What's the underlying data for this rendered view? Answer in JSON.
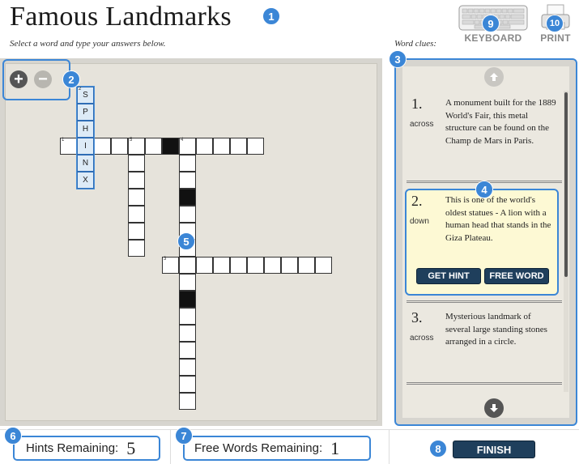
{
  "header": {
    "title": "Famous Landmarks",
    "subtitle": "Select a word and type your answers below.",
    "clues_caption": "Word clues:",
    "keyboard_label": "KEYBOARD",
    "print_label": "PRINT"
  },
  "zoom": {
    "in_icon": "plus-icon",
    "out_icon": "minus-icon"
  },
  "grid": {
    "cells": [
      {
        "r": 0,
        "c": 4,
        "l": "S",
        "n": "2",
        "sel": true
      },
      {
        "r": 1,
        "c": 4,
        "l": "P",
        "sel": true
      },
      {
        "r": 2,
        "c": 4,
        "l": "H",
        "sel": true
      },
      {
        "r": 3,
        "c": 3,
        "n": "1"
      },
      {
        "r": 3,
        "c": 4,
        "l": "I",
        "sel": true
      },
      {
        "r": 3,
        "c": 5
      },
      {
        "r": 3,
        "c": 6
      },
      {
        "r": 3,
        "c": 7,
        "n": "5"
      },
      {
        "r": 3,
        "c": 8
      },
      {
        "r": 3,
        "c": 9,
        "black": true
      },
      {
        "r": 3,
        "c": 10,
        "n": "4"
      },
      {
        "r": 3,
        "c": 11
      },
      {
        "r": 3,
        "c": 12
      },
      {
        "r": 3,
        "c": 13
      },
      {
        "r": 3,
        "c": 14
      },
      {
        "r": 4,
        "c": 4,
        "l": "N",
        "sel": true
      },
      {
        "r": 4,
        "c": 7
      },
      {
        "r": 4,
        "c": 10
      },
      {
        "r": 5,
        "c": 4,
        "l": "X",
        "sel": true
      },
      {
        "r": 5,
        "c": 7
      },
      {
        "r": 5,
        "c": 10
      },
      {
        "r": 6,
        "c": 7
      },
      {
        "r": 6,
        "c": 10,
        "black": true
      },
      {
        "r": 7,
        "c": 7
      },
      {
        "r": 7,
        "c": 10
      },
      {
        "r": 8,
        "c": 7
      },
      {
        "r": 8,
        "c": 10
      },
      {
        "r": 9,
        "c": 7
      },
      {
        "r": 9,
        "c": 10
      },
      {
        "r": 10,
        "c": 9,
        "n": "3"
      },
      {
        "r": 10,
        "c": 10
      },
      {
        "r": 10,
        "c": 11
      },
      {
        "r": 10,
        "c": 12
      },
      {
        "r": 10,
        "c": 13
      },
      {
        "r": 10,
        "c": 14
      },
      {
        "r": 10,
        "c": 15
      },
      {
        "r": 10,
        "c": 16
      },
      {
        "r": 10,
        "c": 17
      },
      {
        "r": 10,
        "c": 18
      },
      {
        "r": 11,
        "c": 10
      },
      {
        "r": 12,
        "c": 10,
        "black": true
      },
      {
        "r": 13,
        "c": 10
      },
      {
        "r": 14,
        "c": 10
      },
      {
        "r": 15,
        "c": 10
      },
      {
        "r": 16,
        "c": 10
      },
      {
        "r": 17,
        "c": 10
      },
      {
        "r": 18,
        "c": 10
      }
    ]
  },
  "clues": [
    {
      "number": "1.",
      "direction": "across",
      "text": "A monument built for the 1889 World's Fair, this metal structure can be found on the Champ de Mars in Paris."
    },
    {
      "number": "2.",
      "direction": "down",
      "text": "This is one of the world's oldest statues - A lion with a human head that stands in the Giza Plateau."
    },
    {
      "number": "3.",
      "direction": "across",
      "text": "Mysterious landmark of several large standing stones arranged in a circle."
    }
  ],
  "clue_buttons": {
    "hint": "GET HINT",
    "free_word": "FREE WORD"
  },
  "footer": {
    "hints_label": "Hints Remaining:",
    "hints_value": "5",
    "free_words_label": "Free Words Remaining:",
    "free_words_value": "1",
    "finish_label": "FINISH"
  },
  "callouts": [
    "1",
    "2",
    "3",
    "4",
    "5",
    "6",
    "7",
    "8",
    "9",
    "10"
  ],
  "colors": {
    "accent": "#3b86d6",
    "button": "#1f3f5c",
    "selected_cell": "#ddebf7",
    "active_clue": "#fdf9d4"
  }
}
